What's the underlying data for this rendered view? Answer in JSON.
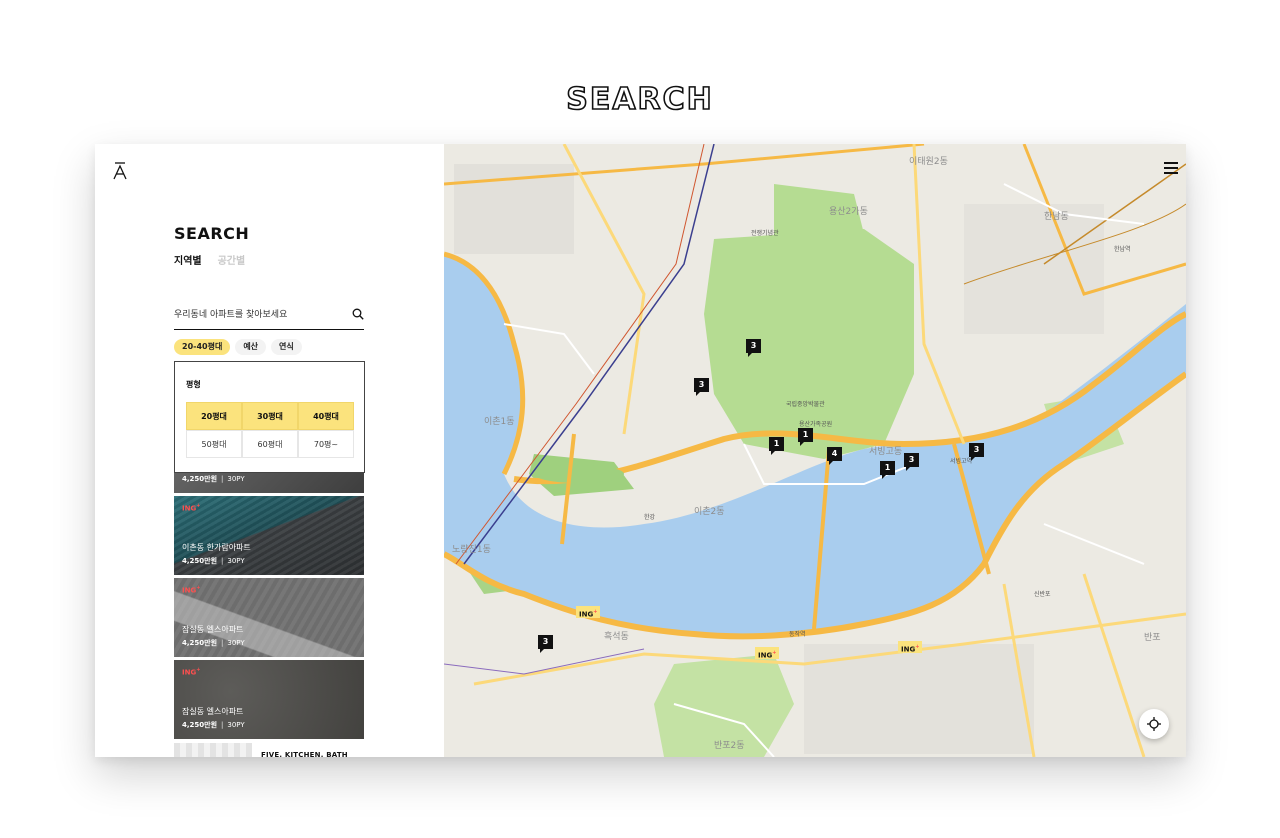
{
  "page": {
    "title": "SEARCH"
  },
  "panel": {
    "title": "SEARCH",
    "tabs": [
      {
        "label": "지역별",
        "active": true
      },
      {
        "label": "공간별",
        "active": false
      }
    ],
    "search": {
      "placeholder": "우리동네 아파트를 찾아보세요",
      "icon": "search-icon"
    },
    "filters": [
      {
        "label": "20-40평대",
        "active": true
      },
      {
        "label": "예산",
        "active": false
      },
      {
        "label": "연식",
        "active": false
      }
    ],
    "dropdown": {
      "title": "평형",
      "options": [
        {
          "label": "20평대",
          "selected": true
        },
        {
          "label": "30평대",
          "selected": true
        },
        {
          "label": "40평대",
          "selected": true
        },
        {
          "label": "50평대",
          "selected": false
        },
        {
          "label": "60평대",
          "selected": false
        },
        {
          "label": "70평~",
          "selected": false
        }
      ]
    },
    "listings": [
      {
        "badge": "",
        "name": "",
        "price": "4,250만원",
        "size": "30PY"
      },
      {
        "badge": "ING",
        "name": "이촌동 한가람아파트",
        "price": "4,250만원",
        "size": "30PY"
      },
      {
        "badge": "ING",
        "name": "잠실동 엘스아파트",
        "price": "4,250만원",
        "size": "30PY"
      },
      {
        "badge": "ING",
        "name": "잠실동 엘스아파트",
        "price": "4,250만원",
        "size": "30PY"
      }
    ],
    "last_listing": {
      "label": "FIVE, KITCHEN, BATH"
    }
  },
  "map": {
    "menu_icon": "hamburger-icon",
    "locate_icon": "crosshair-icon",
    "colors": {
      "water": "#a9cdee",
      "park": "#b5dc92",
      "road": "#f6b945",
      "land": "#eceae3"
    },
    "markers": [
      "3",
      "3",
      "1",
      "1",
      "4",
      "1",
      "3",
      "3",
      "3"
    ],
    "ing_markers": [
      "ING",
      "ING",
      "ING"
    ],
    "area_labels": [
      "이촌1동",
      "용산2가동",
      "이태원2동",
      "한남동",
      "노량진1동",
      "반포2동",
      "이촌2동",
      "서빙고동",
      "흑석동",
      "반포"
    ],
    "place_labels": [
      "국립중앙박물관",
      "서빙고역",
      "동작역",
      "한강",
      "용산가족공원",
      "전쟁기념관",
      "신반포",
      "한남역"
    ]
  }
}
